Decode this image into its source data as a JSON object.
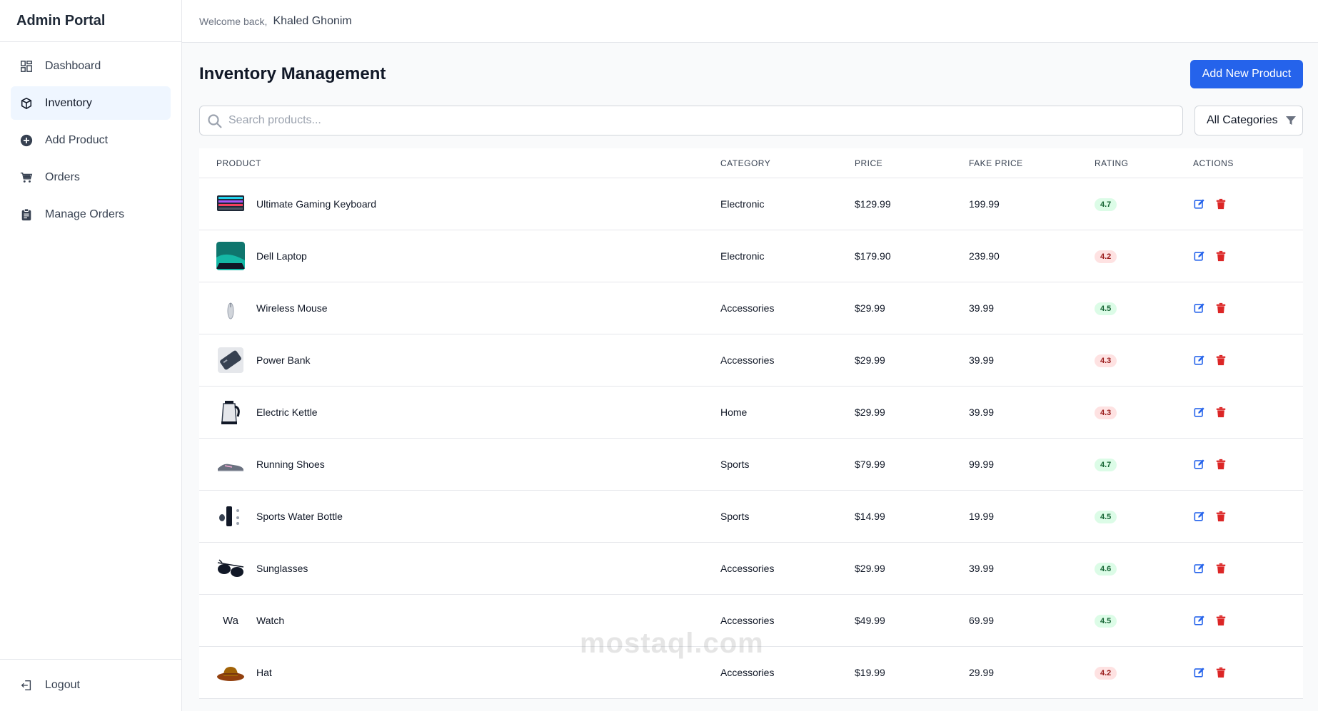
{
  "app": {
    "brand": "Admin Portal"
  },
  "header": {
    "welcome": "Welcome back,",
    "user": "Khaled Ghonim"
  },
  "sidebar": {
    "items": [
      {
        "label": "Dashboard",
        "icon": "dashboard-icon",
        "active": false
      },
      {
        "label": "Inventory",
        "icon": "box-icon",
        "active": true
      },
      {
        "label": "Add Product",
        "icon": "plus-circle-icon",
        "active": false
      },
      {
        "label": "Orders",
        "icon": "cart-icon",
        "active": false
      },
      {
        "label": "Manage Orders",
        "icon": "clipboard-icon",
        "active": false
      }
    ],
    "logout": "Logout"
  },
  "main": {
    "title": "Inventory Management",
    "add_button": "Add New Product",
    "search_placeholder": "Search products...",
    "category_filter": "All Categories"
  },
  "table": {
    "headers": {
      "product": "PRODUCT",
      "category": "CATEGORY",
      "price": "PRICE",
      "fake_price": "FAKE PRICE",
      "rating": "RATING",
      "actions": "ACTIONS"
    },
    "rows": [
      {
        "name": "Ultimate Gaming Keyboard",
        "category": "Electronic",
        "price": "$129.99",
        "fake_price": "199.99",
        "rating": "4.7",
        "rating_level": "green",
        "thumb": "keyboard"
      },
      {
        "name": "Dell Laptop",
        "category": "Electronic",
        "price": "$179.90",
        "fake_price": "239.90",
        "rating": "4.2",
        "rating_level": "red",
        "thumb": "laptop"
      },
      {
        "name": "Wireless Mouse",
        "category": "Accessories",
        "price": "$29.99",
        "fake_price": "39.99",
        "rating": "4.5",
        "rating_level": "green",
        "thumb": "mouse"
      },
      {
        "name": "Power Bank",
        "category": "Accessories",
        "price": "$29.99",
        "fake_price": "39.99",
        "rating": "4.3",
        "rating_level": "red",
        "thumb": "powerbank"
      },
      {
        "name": "Electric Kettle",
        "category": "Home",
        "price": "$29.99",
        "fake_price": "39.99",
        "rating": "4.3",
        "rating_level": "red",
        "thumb": "kettle"
      },
      {
        "name": "Running Shoes",
        "category": "Sports",
        "price": "$79.99",
        "fake_price": "99.99",
        "rating": "4.7",
        "rating_level": "green",
        "thumb": "shoes"
      },
      {
        "name": "Sports Water Bottle",
        "category": "Sports",
        "price": "$14.99",
        "fake_price": "19.99",
        "rating": "4.5",
        "rating_level": "green",
        "thumb": "bottle"
      },
      {
        "name": "Sunglasses",
        "category": "Accessories",
        "price": "$29.99",
        "fake_price": "39.99",
        "rating": "4.6",
        "rating_level": "green",
        "thumb": "sunglasses"
      },
      {
        "name": "Watch",
        "category": "Accessories",
        "price": "$49.99",
        "fake_price": "69.99",
        "rating": "4.5",
        "rating_level": "green",
        "thumb": "broken",
        "thumb_alt": "Wa"
      },
      {
        "name": "Hat",
        "category": "Accessories",
        "price": "$19.99",
        "fake_price": "29.99",
        "rating": "4.2",
        "rating_level": "red",
        "thumb": "hat"
      }
    ]
  },
  "colors": {
    "accent": "#2563eb",
    "danger": "#dc2626",
    "good": "#166534",
    "bad": "#991b1b"
  },
  "watermark": "mostaql.com"
}
